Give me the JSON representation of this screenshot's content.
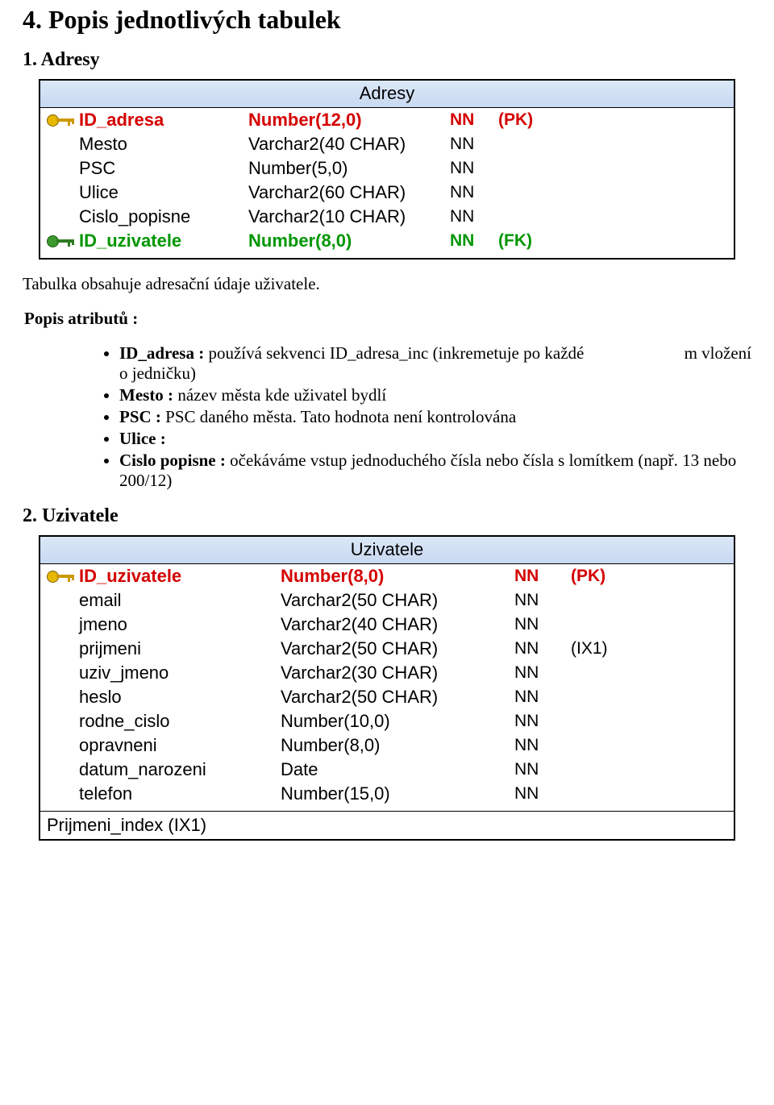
{
  "headings": {
    "section": "4. Popis jednotlivých tabulek",
    "sub1": "1. Adresy",
    "sub2": "2. Uzivatele"
  },
  "text": {
    "table1_caption": "Tabulka obsahuje adresační údaje uživatele.",
    "popis_heading": "Popis atributů :"
  },
  "attrs": {
    "id_adresa_label": "ID_adresa : ",
    "id_adresa_desc": "používá sekvenci ID_adresa_inc (inkremetuje po každé",
    "id_adresa_tail": "m vložení",
    "id_adresa_line2": "o jedničku)",
    "mesto_label": "Mesto :",
    "mesto_desc": " název města kde uživatel bydlí",
    "psc_label": "PSC :",
    "psc_desc": " PSC daného města. Tato hodnota není kontrolována",
    "ulice_label": "Ulice :",
    "cislo_label": "Cislo popisne :",
    "cislo_desc": " očekáváme vstup jednoduchého čísla nebo čísla s lomítkem (např. 13 nebo  200/12)"
  },
  "table1": {
    "title": "Adresy",
    "rows": [
      {
        "icon": "pk",
        "name": "ID_adresa",
        "type": "Number(12,0)",
        "nn": "NN",
        "extra": "(PK)",
        "cls": "pk"
      },
      {
        "icon": "",
        "name": "Mesto",
        "type": "Varchar2(40 CHAR)",
        "nn": "NN",
        "extra": "",
        "cls": ""
      },
      {
        "icon": "",
        "name": "PSC",
        "type": "Number(5,0)",
        "nn": "NN",
        "extra": "",
        "cls": ""
      },
      {
        "icon": "",
        "name": "Ulice",
        "type": "Varchar2(60 CHAR)",
        "nn": "NN",
        "extra": "",
        "cls": ""
      },
      {
        "icon": "",
        "name": "Cislo_popisne",
        "type": "Varchar2(10 CHAR)",
        "nn": "NN",
        "extra": "",
        "cls": ""
      },
      {
        "icon": "fk",
        "name": "ID_uzivatele",
        "type": "Number(8,0)",
        "nn": "NN",
        "extra": "(FK)",
        "cls": "fk"
      }
    ]
  },
  "table2": {
    "title": "Uzivatele",
    "rows": [
      {
        "icon": "pk",
        "name": "ID_uzivatele",
        "type": "Number(8,0)",
        "nn": "NN",
        "extra": "(PK)",
        "cls": "pk"
      },
      {
        "icon": "",
        "name": "email",
        "type": "Varchar2(50 CHAR)",
        "nn": "NN",
        "extra": "",
        "cls": ""
      },
      {
        "icon": "",
        "name": "jmeno",
        "type": "Varchar2(40 CHAR)",
        "nn": "NN",
        "extra": "",
        "cls": ""
      },
      {
        "icon": "",
        "name": "prijmeni",
        "type": "Varchar2(50 CHAR)",
        "nn": "NN",
        "extra": "(IX1)",
        "cls": ""
      },
      {
        "icon": "",
        "name": "uziv_jmeno",
        "type": "Varchar2(30 CHAR)",
        "nn": "NN",
        "extra": "",
        "cls": ""
      },
      {
        "icon": "",
        "name": "heslo",
        "type": "Varchar2(50 CHAR)",
        "nn": "NN",
        "extra": "",
        "cls": ""
      },
      {
        "icon": "",
        "name": "rodne_cislo",
        "type": "Number(10,0)",
        "nn": "NN",
        "extra": "",
        "cls": ""
      },
      {
        "icon": "",
        "name": "opravneni",
        "type": "Number(8,0)",
        "nn": "NN",
        "extra": "",
        "cls": ""
      },
      {
        "icon": "",
        "name": "datum_narozeni",
        "type": "Date",
        "nn": "NN",
        "extra": "",
        "cls": ""
      },
      {
        "icon": "",
        "name": "telefon",
        "type": "Number(15,0)",
        "nn": "NN",
        "extra": "",
        "cls": ""
      }
    ],
    "index": "Prijmeni_index (IX1)"
  }
}
